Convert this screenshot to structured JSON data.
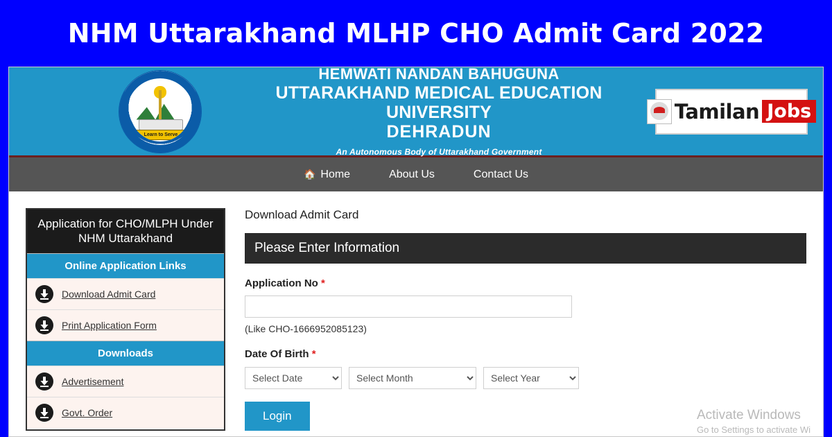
{
  "banner": {
    "title": "NHM Uttarakhand MLHP CHO Admit Card 2022"
  },
  "site_header": {
    "logo_ribbon": "Learn to Serve",
    "line1": "HEMWATI NANDAN BAHUGUNA",
    "line2": "UTTARAKHAND MEDICAL EDUCATION UNIVERSITY",
    "line3": "DEHRADUN",
    "subtitle": "An Autonomous Body of Uttarakhand Government",
    "brand": {
      "name": "Tamilan",
      "highlight": "Jobs"
    }
  },
  "nav": {
    "items": [
      {
        "label": "Home",
        "icon": "home-icon"
      },
      {
        "label": "About Us",
        "icon": ""
      },
      {
        "label": "Contact Us",
        "icon": ""
      }
    ]
  },
  "sidebar": {
    "title": "Application for CHO/MLPH Under NHM Uttarakhand",
    "sections": [
      {
        "heading": "Online Application Links",
        "items": [
          {
            "label": "Download Admit Card",
            "icon": "download-icon"
          },
          {
            "label": "Print Application Form",
            "icon": "download-icon"
          }
        ]
      },
      {
        "heading": "Downloads",
        "items": [
          {
            "label": "Advertisement",
            "icon": "download-icon"
          },
          {
            "label": "Govt. Order",
            "icon": "download-icon"
          }
        ]
      }
    ]
  },
  "main": {
    "page_title": "Download Admit Card",
    "panel_title": "Please Enter Information",
    "application_no": {
      "label": "Application No",
      "required_mark": "*",
      "value": "",
      "placeholder": "",
      "hint": "(Like CHO-1666952085123)"
    },
    "dob": {
      "label": "Date Of Birth",
      "required_mark": "*",
      "day": "Select Date",
      "month": "Select Month",
      "year": "Select Year"
    },
    "login_label": "Login"
  },
  "watermark": {
    "line1": "Activate Windows",
    "line2": "Go to Settings to activate Wi"
  }
}
